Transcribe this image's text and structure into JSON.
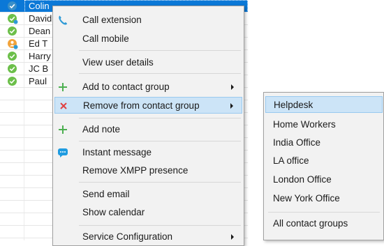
{
  "contacts": [
    {
      "name": "Colin",
      "status": "available-selected",
      "selected": true
    },
    {
      "name": "David",
      "status": "available-phone",
      "selected": false
    },
    {
      "name": "Dean",
      "status": "available",
      "selected": false
    },
    {
      "name": "Ed T",
      "status": "away-person",
      "selected": false
    },
    {
      "name": "Harry",
      "status": "available",
      "selected": false
    },
    {
      "name": "JC B",
      "status": "available",
      "selected": false
    },
    {
      "name": "Paul",
      "status": "available",
      "selected": false
    }
  ],
  "colors": {
    "selection": "#0b78d7",
    "menu_background": "#f2f2f2",
    "menu_highlight": "#cce4f7",
    "status_available": "#6cbf4a",
    "status_away": "#f2a33a",
    "status_selected": "#3a8fc8",
    "phone_icon": "#2f9ad6",
    "add_icon": "#4caf50",
    "remove_icon": "#e04040",
    "chat_icon": "#1e9be0"
  },
  "context_menu": {
    "items": [
      {
        "label": "Call extension",
        "icon": "phone-icon",
        "submenu": false
      },
      {
        "label": "Call mobile",
        "icon": "",
        "submenu": false
      },
      {
        "label": "View user details",
        "icon": "",
        "submenu": false
      },
      {
        "label": "Add to contact group",
        "icon": "plus-icon",
        "submenu": true
      },
      {
        "label": "Remove from contact group",
        "icon": "remove-icon",
        "submenu": true,
        "highlighted": true
      },
      {
        "label": "Add note",
        "icon": "plus-icon",
        "submenu": false
      },
      {
        "label": "Instant message",
        "icon": "chat-bubble-icon",
        "submenu": false
      },
      {
        "label": "Remove XMPP presence",
        "icon": "",
        "submenu": false
      },
      {
        "label": "Send email",
        "icon": "",
        "submenu": false
      },
      {
        "label": "Show calendar",
        "icon": "",
        "submenu": false
      },
      {
        "label": "Service Configuration",
        "icon": "",
        "submenu": true
      }
    ]
  },
  "submenu": {
    "items": [
      {
        "label": "Helpdesk",
        "highlighted": true
      },
      {
        "label": "Home Workers"
      },
      {
        "label": "India Office"
      },
      {
        "label": "LA office"
      },
      {
        "label": "London Office"
      },
      {
        "label": "New York Office"
      },
      {
        "label": "All contact groups"
      }
    ]
  }
}
